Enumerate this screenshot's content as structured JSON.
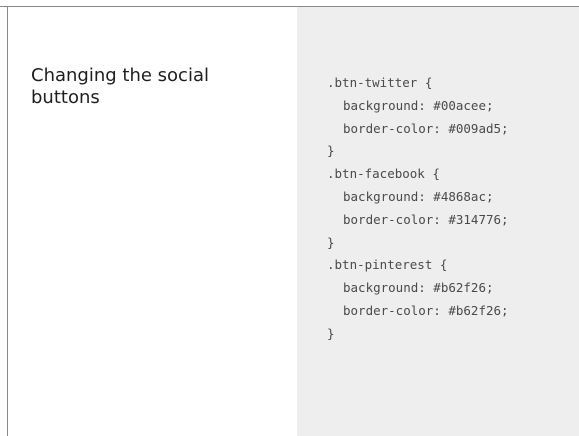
{
  "slide": {
    "title": "Changing the social buttons",
    "code_lines": [
      ".btn-twitter {",
      "background: #00acee;",
      "border-color: #009ad5;",
      "}",
      ".btn-facebook {",
      "background: #4868ac;",
      "border-color: #314776;",
      "}",
      ".btn-pinterest {",
      "background: #b62f26;",
      "border-color: #b62f26;",
      "}"
    ]
  },
  "colors": {
    "code_panel_background": "#eeeeee",
    "title_text": "#1e1e1e",
    "code_text": "#4a4a4a",
    "frame_line": "#8a8a8a"
  }
}
